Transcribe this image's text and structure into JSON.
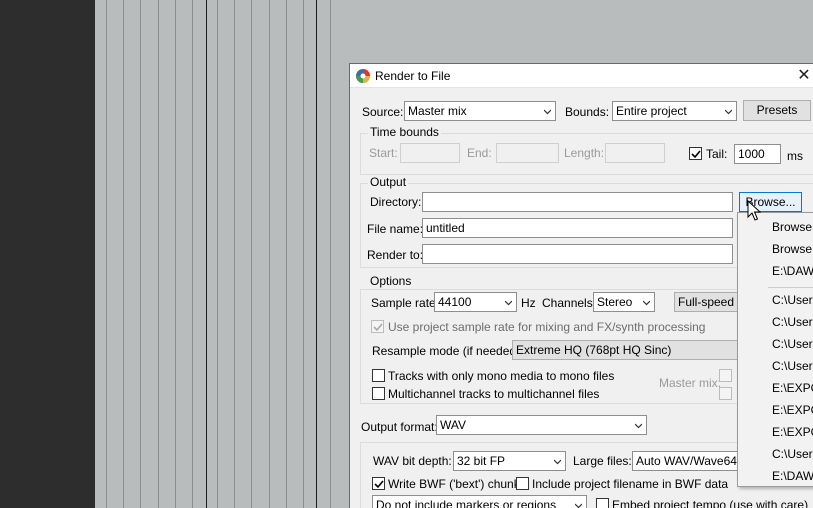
{
  "dialog": {
    "title": "Render to File",
    "close_glyph": "✕",
    "source_label": "Source:",
    "source_value": "Master mix",
    "bounds_label": "Bounds:",
    "bounds_value": "Entire project",
    "presets_label": "Presets",
    "time_bounds": {
      "title": "Time bounds",
      "start_label": "Start:",
      "end_label": "End:",
      "length_label": "Length:",
      "tail_label": "Tail:",
      "tail_checked": true,
      "tail_value": "1000",
      "tail_unit": "ms"
    },
    "output": {
      "title": "Output",
      "directory_label": "Directory:",
      "directory_value": "",
      "browse_label": "Browse...",
      "filename_label": "File name:",
      "filename_value": "untitled",
      "render_to_label": "Render to:",
      "render_to_value": ""
    },
    "options": {
      "title": "Options",
      "sample_rate_label": "Sample rate:",
      "sample_rate_value": "44100",
      "hz_label": "Hz",
      "channels_label": "Channels:",
      "channels_value": "Stereo",
      "speed_label": "Full-speed O",
      "use_project_rate_label": "Use project sample rate for mixing and FX/synth processing",
      "resample_label": "Resample mode (if needed):",
      "resample_value": "Extreme HQ (768pt HQ Sinc)",
      "mono_label": "Tracks with only mono media to mono files",
      "multichannel_label": "Multichannel tracks to multichannel files",
      "master_mix_label": "Master mix:"
    },
    "output_format": {
      "label": "Output format:",
      "value": "WAV",
      "bit_depth_label": "WAV bit depth:",
      "bit_depth_value": "32 bit FP",
      "large_files_label": "Large files:",
      "large_files_value": "Auto WAV/Wave64",
      "bwf_label": "Write BWF ('bext') chunk",
      "bwf_checked": true,
      "include_filename_label": "Include project filename in BWF data",
      "markers_value": "Do not include markers or regions",
      "embed_tempo_label": "Embed project tempo (use with care)"
    }
  },
  "menu": {
    "items": [
      "Browse",
      "Browse",
      "E:\\DAW_"
    ],
    "recent": [
      "C:\\Users",
      "C:\\Users",
      "C:\\Users",
      "C:\\Users",
      "E:\\EXPO",
      "E:\\EXPO",
      "E:\\EXPO",
      "C:\\Users",
      "E:\\DAW_"
    ]
  },
  "colors": {
    "accent": "#0078d7",
    "track_bg": "#b9bcbd",
    "dialog_bg": "#f0f0f0"
  }
}
